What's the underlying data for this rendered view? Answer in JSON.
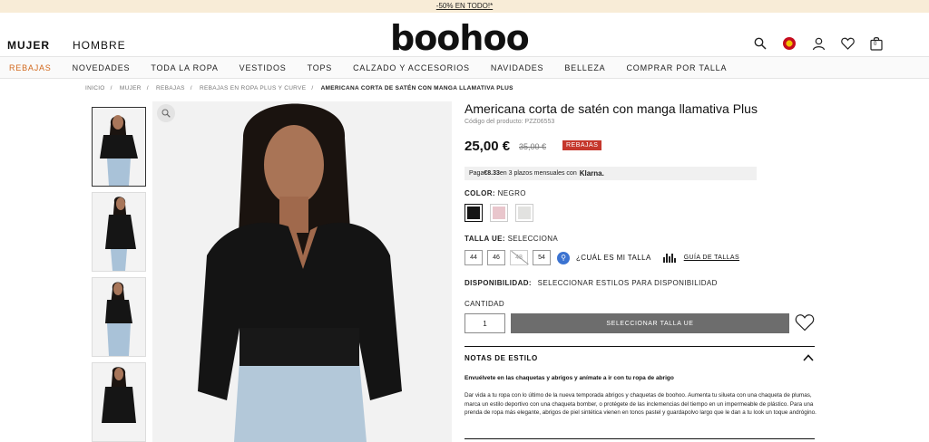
{
  "promo": {
    "text": "-50% EN TODO!*"
  },
  "header": {
    "gender_women": "MUJER",
    "gender_men": "HOMBRE",
    "logo": "boohoo",
    "bag_count": "0"
  },
  "nav": {
    "items": [
      "REBAJAS",
      "NOVEDADES",
      "TODA LA ROPA",
      "VESTIDOS",
      "TOPS",
      "CALZADO Y ACCESORIOS",
      "NAVIDADES",
      "BELLEZA",
      "COMPRAR POR TALLA"
    ]
  },
  "breadcrumb": [
    "INICIO",
    "MUJER",
    "REBAJAS",
    "REBAJAS EN ROPA PLUS Y CURVE",
    "AMERICANA CORTA DE SATÉN CON MANGA LLAMATIVA PLUS"
  ],
  "product": {
    "title": "Americana corta de satén con manga llamativa Plus",
    "sku": "Código del producto: PZZ06553",
    "price": "25,00 €",
    "old_price": "35,00 €",
    "badge": "REBAJAS",
    "klarna_pre": "Paga ",
    "klarna_amount": "€8.33",
    "klarna_post": " en 3 plazos mensuales con ",
    "klarna_brand": "Klarna."
  },
  "color": {
    "label": "COLOR:",
    "value": "NEGRO",
    "swatches": [
      {
        "name": "black",
        "hex": "#151515"
      },
      {
        "name": "pink",
        "hex": "#e9c6cc"
      },
      {
        "name": "grey",
        "hex": "#e2e2e0"
      }
    ]
  },
  "size": {
    "label": "TALLA UE:",
    "value": "SELECCIONA",
    "options": [
      "44",
      "46",
      "48",
      "54"
    ],
    "fit_label": "¿CUÁL ES MI TALLA",
    "guide_label": "GUÍA DE TALLAS"
  },
  "availability": {
    "label": "DISPONIBILIDAD:",
    "value": "SELECCIONAR ESTILOS PARA DISPONIBILIDAD"
  },
  "quantity": {
    "label": "CANTIDAD",
    "value": "1"
  },
  "cta": {
    "label": "SELECCIONAR TALLA UE"
  },
  "notes": {
    "title": "NOTAS DE ESTILO",
    "lead": "Envuélvete en las chaquetas y abrigos y anímate a ir con tu ropa de abrigo",
    "body": "Dar vida a tu ropa con lo último de la nueva temporada abrigos y chaquetas de boohoo. Aumenta tu silueta con una chaqueta de plumas, marca un estilo deportivo con una chaqueta bomber, o protégete de las inclemencias del tiempo en un impermeable de plástico. Para una prenda de ropa más elegante, abrigos de piel sintética vienen en tonos pastel y guardapolvo largo que le dan a tu look un toque andrógino."
  },
  "colors": {
    "sale_nav": "#d2691e",
    "badge": "#c5372c",
    "cta": "#6d6d6d",
    "promo_bg": "#f8ecd7"
  }
}
